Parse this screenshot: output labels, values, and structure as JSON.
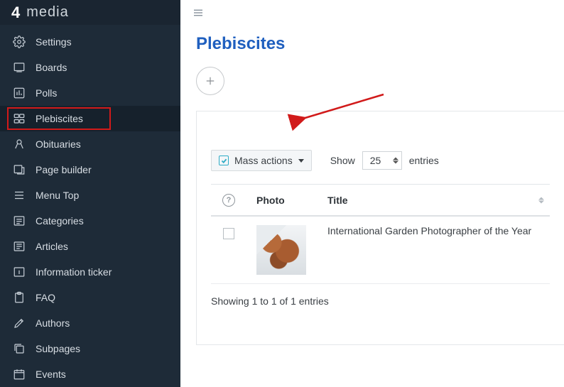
{
  "brand": {
    "mark": "4",
    "text": "media"
  },
  "sidebar": {
    "items": [
      {
        "label": "Settings"
      },
      {
        "label": "Boards"
      },
      {
        "label": "Polls"
      },
      {
        "label": "Plebiscites"
      },
      {
        "label": "Obituaries"
      },
      {
        "label": "Page builder"
      },
      {
        "label": "Menu Top"
      },
      {
        "label": "Categories"
      },
      {
        "label": "Articles"
      },
      {
        "label": "Information ticker"
      },
      {
        "label": "FAQ"
      },
      {
        "label": "Authors"
      },
      {
        "label": "Subpages"
      },
      {
        "label": "Events"
      }
    ],
    "active_index": 3
  },
  "page": {
    "title": "Plebiscites"
  },
  "controls": {
    "mass_actions_label": "Mass actions",
    "show_label": "Show",
    "entries_label": "entries",
    "page_size": "25"
  },
  "table": {
    "columns": {
      "photo": "Photo",
      "title": "Title"
    },
    "rows": [
      {
        "title": "International Garden Photographer of the Year"
      }
    ],
    "footer": "Showing 1 to 1 of 1 entries"
  }
}
